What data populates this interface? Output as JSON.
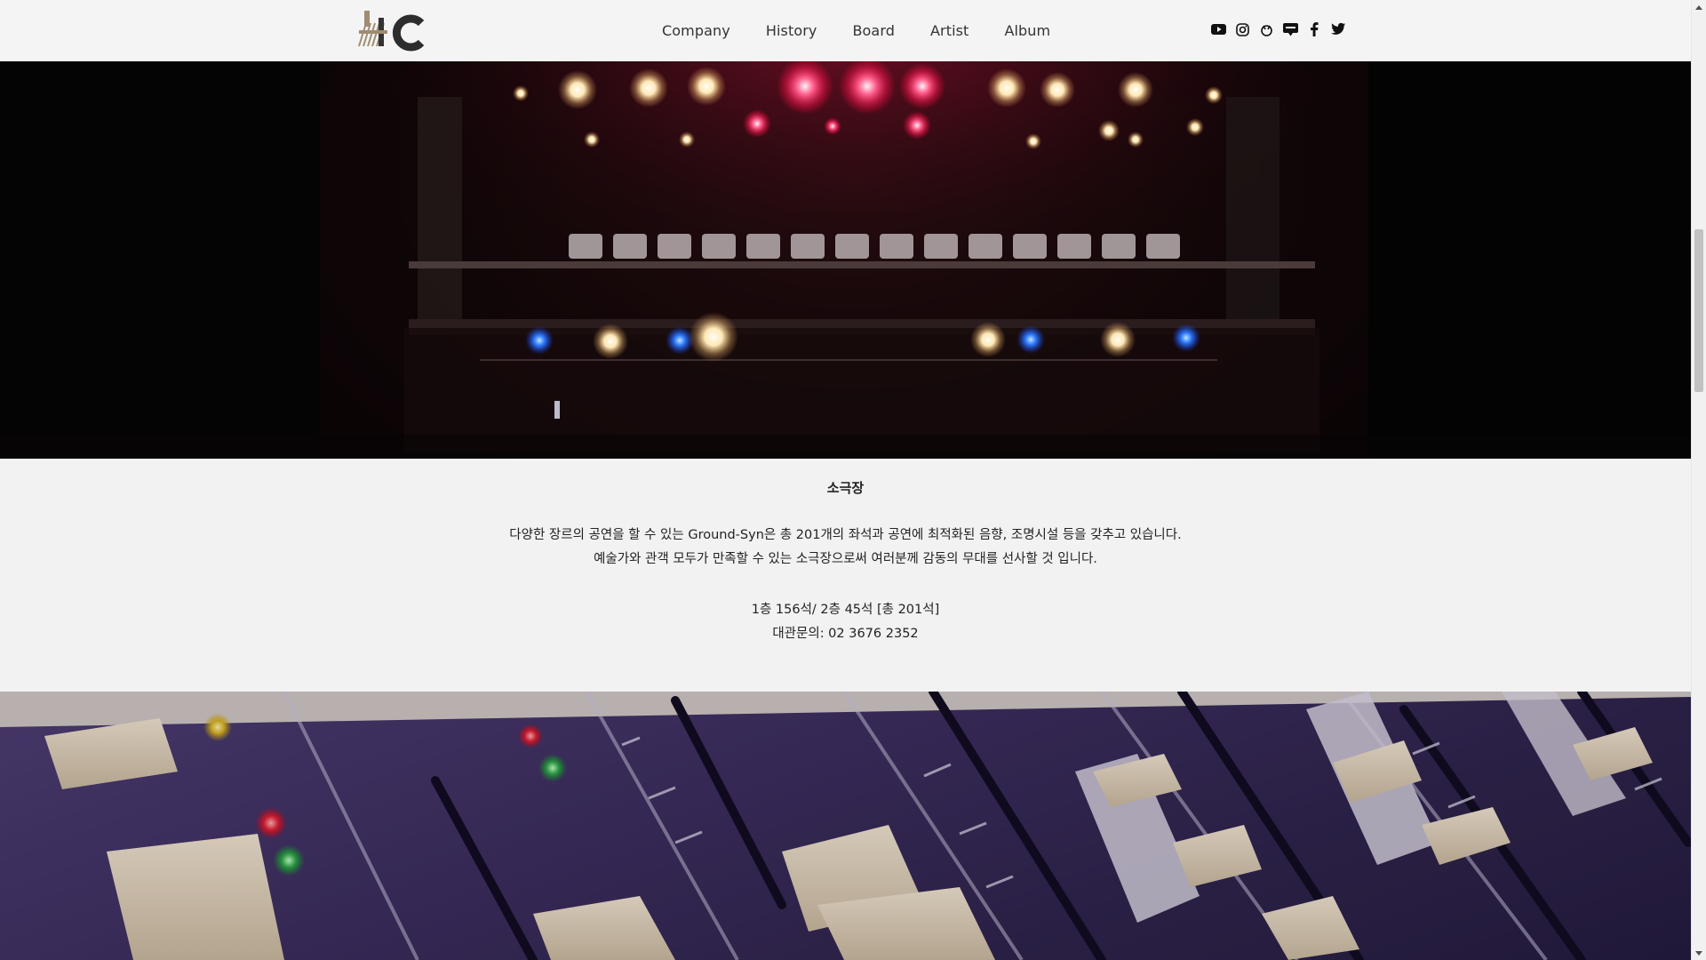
{
  "nav": {
    "items": [
      "Company",
      "History",
      "Board",
      "Artist",
      "Album"
    ]
  },
  "social": {
    "icons": [
      "youtube-icon",
      "instagram-icon",
      "naver-post-icon",
      "blog-icon",
      "facebook-icon",
      "twitter-icon"
    ]
  },
  "venue": {
    "title": "소극장",
    "desc_line1": "다양한 장르의 공연을 할 수 있는 Ground-Syn은 총 201개의 좌석과 공연에 최적화된 음향, 조명시설 등을 갖추고 있습니다.",
    "desc_line2": "예술가와 관객 모두가 만족할 수 있는 소극장으로써 여러분께 감동의 무대를 선사할 것 입니다.",
    "seats": "1층 156석/ 2층 45석 [총 201석]",
    "contact": "대관문의: 02 3676 2352"
  },
  "colors": {
    "header_bg": "#f4f4f4",
    "page_bg": "#f2f2f2",
    "text": "#222222"
  }
}
